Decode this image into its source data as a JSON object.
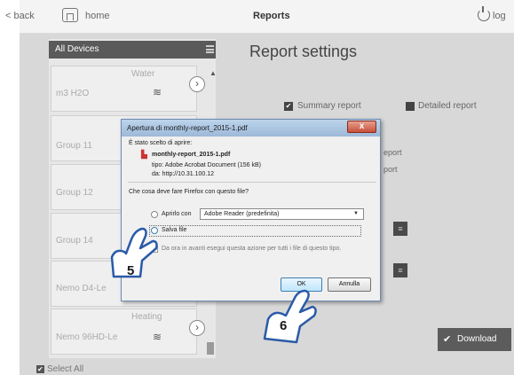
{
  "topbar": {
    "back_label": "back",
    "home_label": "home",
    "title": "Reports",
    "logout_label": "log"
  },
  "sidebar": {
    "header": "All Devices",
    "select_all_label": "Select All",
    "cards": [
      {
        "name": "m3 H2O",
        "category": "Water"
      },
      {
        "name": "Group 11",
        "category": ""
      },
      {
        "name": "Group 12",
        "category": ""
      },
      {
        "name": "Group 14",
        "category": ""
      },
      {
        "name": "Nemo D4-Le",
        "category": ""
      },
      {
        "name": "Nemo 96HD-Le",
        "category": "Heating"
      }
    ]
  },
  "settings": {
    "title": "Report settings",
    "summary_label": "Summary report",
    "detailed_label": "Detailed report",
    "side_text_1": "eport",
    "side_text_2": "port",
    "download_label": "Download"
  },
  "dialog": {
    "title": "Apertura di monthly-report_2015-1.pdf",
    "close_label": "x",
    "intro": "È stato scelto di aprire:",
    "filename": "monthly-report_2015-1.pdf",
    "type_line": "tipo: Adobe Acrobat Document (156 kB)",
    "from_line": "da: http://10.31.100.12",
    "question": "Che cosa deve fare Firefox con questo file?",
    "open_with_label": "Aprirlo con",
    "open_with_value": "Adobe Reader (predefinita)",
    "save_label": "Salva file",
    "remember_label": "Da ora in avanti esegui questa azione per tutti i file di questo tipo.",
    "ok_label": "OK",
    "cancel_label": "Annulla"
  },
  "callouts": {
    "step5": "5",
    "step6": "6"
  },
  "icons": {
    "wifi": "wifi-icon",
    "pdf": "pdf-icon",
    "power": "power-icon",
    "home": "home-icon"
  },
  "colors": {
    "accent_blue": "#3c7fb1",
    "dialog_border": "#6d8bb3"
  }
}
